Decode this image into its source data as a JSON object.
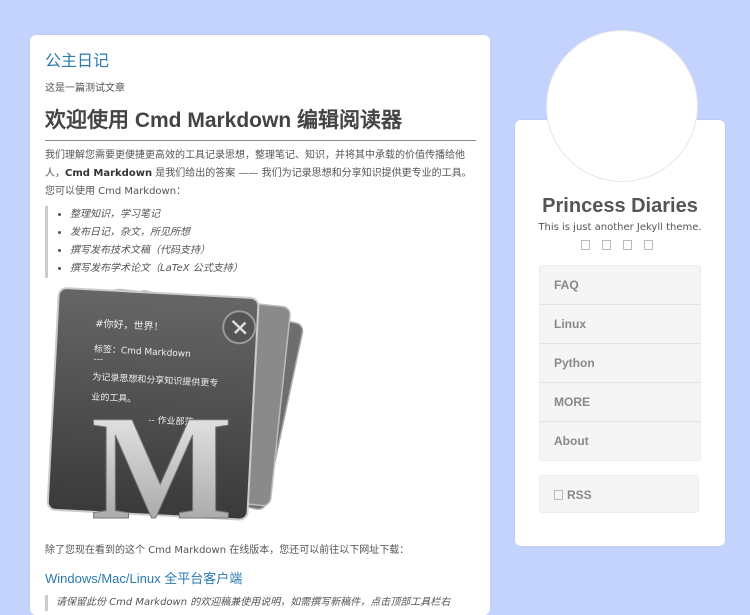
{
  "post": {
    "title": "公主日记",
    "subtitle": "这是一篇测试文章",
    "heading": "欢迎使用 Cmd Markdown 编辑阅读器",
    "intro_before": "我们理解您需要更便捷更高效的工具记录思想，整理笔记、知识，并将其中承载的价值传播给他人，",
    "intro_strong": "Cmd Markdown",
    "intro_after": " 是我们给出的答案 —— 我们为记录思想和分享知识提供更专业的工具。 您可以使用 Cmd Markdown：",
    "list": [
      "整理知识，学习笔记",
      "发布日记，杂文，所见所想",
      "撰写发布技术文稿（代码支持）",
      "撰写发布学术论文（LaTeX 公式支持）"
    ],
    "logo": {
      "line1": "#你好，世界！",
      "line2": "标签：Cmd Markdown",
      "line3": "---",
      "line4": "为记录思想和分享知识提供更专",
      "line5": "业的工具。",
      "line6": "-- 作业部落",
      "letter": "M"
    },
    "download_text": "除了您现在看到的这个 Cmd Markdown 在线版本，您还可以前往以下网址下载：",
    "download_link": "Windows/Mac/Linux 全平台客户端",
    "tip": "请保留此份 Cmd Markdown 的欢迎稿兼使用说明，如需撰写新稿件，点击顶部工具栏右"
  },
  "sidebar": {
    "title": "Princess Diaries",
    "description": "This is just another Jekyll theme.",
    "social_icons": [
      "github-icon",
      "weibo-icon",
      "zhihu-icon",
      "mail-icon"
    ],
    "nav": [
      "FAQ",
      "Linux",
      "Python",
      "MORE",
      "About"
    ],
    "rss": "RSS"
  }
}
